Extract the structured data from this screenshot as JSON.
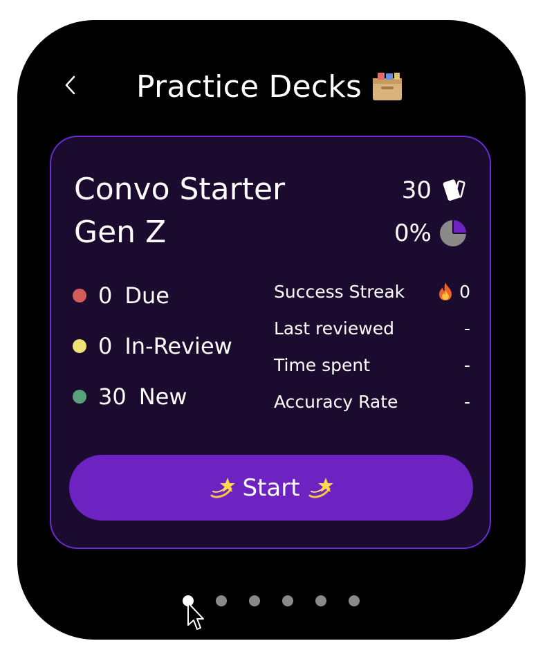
{
  "header": {
    "title": "Practice Decks",
    "back_icon": "chevron-left-icon",
    "title_icon": "card-box-icon"
  },
  "deck": {
    "name_line1": "Convo Starter",
    "name_line2": "Gen Z",
    "card_count": "30",
    "card_icon": "cards-icon",
    "progress_text": "0%",
    "progress_icon": "pie-chart-icon"
  },
  "stats": [
    {
      "count": "0",
      "label": "Due",
      "color": "#d45c5c"
    },
    {
      "count": "0",
      "label": "In-Review",
      "color": "#eee373"
    },
    {
      "count": "30",
      "label": "New",
      "color": "#5aa07a"
    }
  ],
  "details": [
    {
      "label": "Success Streak",
      "value": "0",
      "icon": "fire-icon"
    },
    {
      "label": "Last reviewed",
      "value": "-"
    },
    {
      "label": "Time spent",
      "value": "-"
    },
    {
      "label": "Accuracy Rate",
      "value": "-"
    }
  ],
  "start_button": {
    "label": "Start",
    "icon": "dizzy-star-icon"
  },
  "pager": {
    "total": 6,
    "active_index": 0
  },
  "colors": {
    "background": "#000000",
    "card": "#1b0b2e",
    "card_border": "#6b2bd6",
    "accent": "#6d22c2"
  }
}
